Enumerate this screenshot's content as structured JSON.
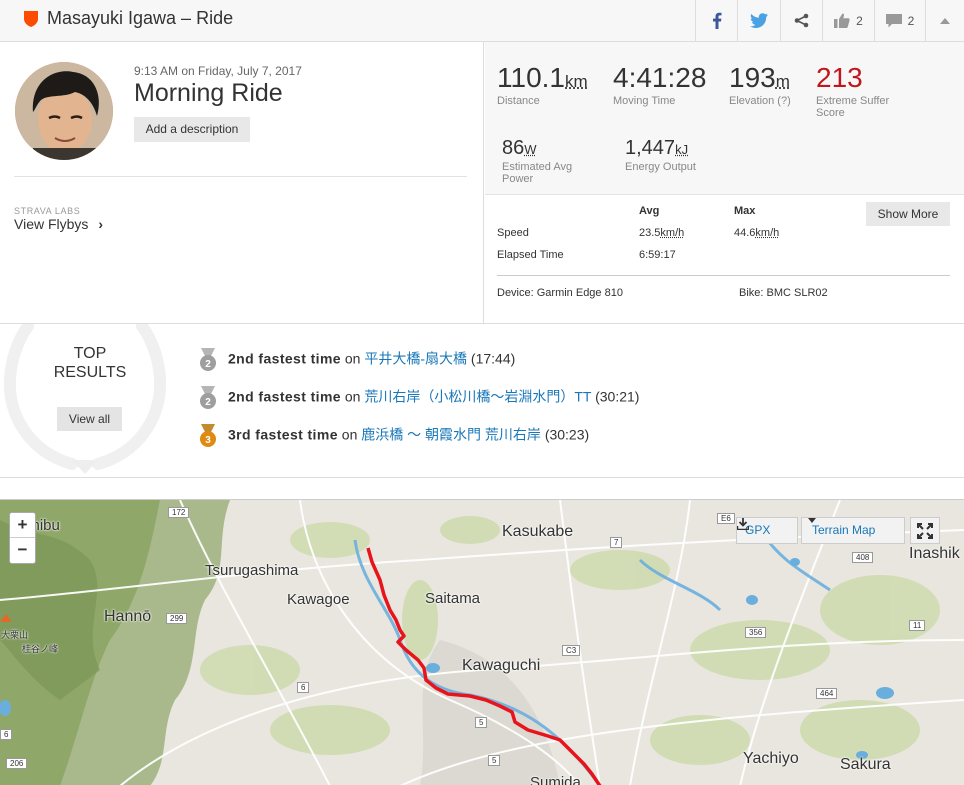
{
  "header": {
    "title": "Masayuki Igawa – Ride",
    "like_count": "2",
    "comment_count": "2"
  },
  "activity": {
    "date": "9:13 AM on Friday, July 7, 2017",
    "title": "Morning Ride",
    "add_description": "Add a description",
    "labs_label": "STRAVA LABS",
    "flybys_label": "View Flybys",
    "flybys_chevron": "›"
  },
  "stats": {
    "distance": {
      "value": "110.1",
      "unit": "km",
      "label": "Distance"
    },
    "moving_time": {
      "value": "4:41:28",
      "label": "Moving Time"
    },
    "elevation": {
      "value": "193",
      "unit": "m",
      "label": "Elevation (?)"
    },
    "suffer": {
      "value": "213",
      "label1": "Extreme Suffer",
      "label2": "Score"
    },
    "power": {
      "value": "86",
      "unit": "W",
      "label1": "Estimated Avg",
      "label2": "Power"
    },
    "energy": {
      "value": "1,447",
      "unit": "kJ",
      "label": "Energy Output"
    }
  },
  "more_stats": {
    "show_more": "Show More",
    "col_avg": "Avg",
    "col_max": "Max",
    "speed_label": "Speed",
    "speed_avg": "23.5",
    "speed_max": "44.6",
    "speed_unit": "km/h",
    "elapsed_label": "Elapsed Time",
    "elapsed_avg": "6:59:17",
    "device": "Device: Garmin Edge 810",
    "bike": "Bike: BMC SLR02"
  },
  "top_results": {
    "label1": "TOP",
    "label2": "RESULTS",
    "view_all": "View all",
    "items": [
      {
        "rank": "2",
        "rank_text": "2nd fastest time",
        "on": "on",
        "segment": "平井大橋-扇大橋",
        "time": "(17:44)"
      },
      {
        "rank": "2",
        "rank_text": "2nd fastest time",
        "on": "on",
        "segment": "荒川右岸（小松川橋〜岩淵水門）TT",
        "time": "(30:21)"
      },
      {
        "rank": "3",
        "rank_text": "3rd fastest time",
        "on": "on",
        "segment": "鹿浜橋 〜 朝霞水門 荒川右岸",
        "time": "(30:23)"
      }
    ]
  },
  "map": {
    "zoom_in": "+",
    "zoom_out": "−",
    "gpx": "GPX",
    "map_type": "Terrain Map",
    "places": {
      "kasukabe": "Kasukabe",
      "inashiki": "Inashik",
      "tsurugashima": "Tsurugashima",
      "kawagoe": "Kawagoe",
      "saitama": "Saitama",
      "hanno": "Hannō",
      "kawaguchi": "Kawaguchi",
      "yachiyo": "Yachiyo",
      "sakura": "Sakura",
      "sumida": "Sumida",
      "chichibu": "chibu",
      "oaza": "大栗山",
      "peak": "桂谷ノ峰"
    },
    "routes": [
      "172",
      "7",
      "E6",
      "408",
      "299",
      "356",
      "11",
      "C3",
      "6",
      "464",
      "5",
      "5",
      "6",
      "206"
    ],
    "colors": {
      "route": "#e8141c",
      "water": "#6aaede",
      "forest": "#8fa86a"
    }
  },
  "colors": {
    "brand": "#fc4c02",
    "link": "#1877b8",
    "suffer": "#c0171c"
  }
}
